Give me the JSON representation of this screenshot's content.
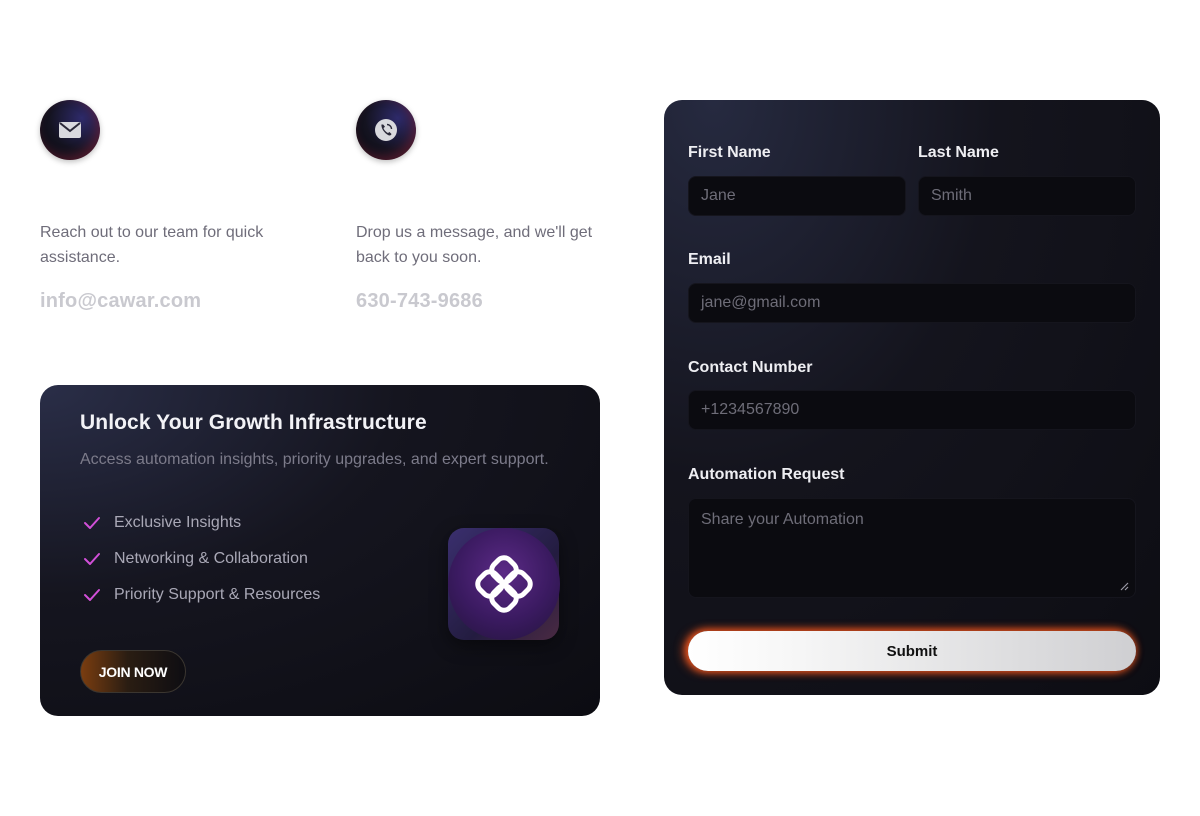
{
  "contacts": {
    "email": {
      "icon": "envelope-icon",
      "description": "Reach out to our team for quick assistance.",
      "value": "info@cawar.com"
    },
    "phone": {
      "icon": "phone-icon",
      "description": "Drop us a message, and we'll get back to you soon.",
      "value": "630-743-9686"
    }
  },
  "promo": {
    "title": "Unlock Your Growth Infrastructure",
    "subtitle": "Access automation insights, priority upgrades, and expert support.",
    "features": [
      {
        "label": "Exclusive Insights",
        "icon": "check-icon"
      },
      {
        "label": "Networking & Collaboration",
        "icon": "check-icon"
      },
      {
        "label": "Priority Support & Resources",
        "icon": "check-icon"
      }
    ],
    "cta_label": "JOIN NOW",
    "logo": "brand-logo-icon"
  },
  "form": {
    "first_name": {
      "label": "First Name",
      "placeholder": "Jane"
    },
    "last_name": {
      "label": "Last Name",
      "placeholder": "Smith"
    },
    "email": {
      "label": "Email",
      "placeholder": "jane@gmail.com"
    },
    "contact_number": {
      "label": "Contact Number",
      "placeholder": "+1234567890"
    },
    "automation_request": {
      "label": "Automation Request",
      "placeholder": "Share your Automation"
    },
    "submit_label": "Submit"
  },
  "colors": {
    "accent_check": "#d24fd8",
    "submit_glow": "#ff5a1e",
    "card_dark": "#0d0d13"
  }
}
